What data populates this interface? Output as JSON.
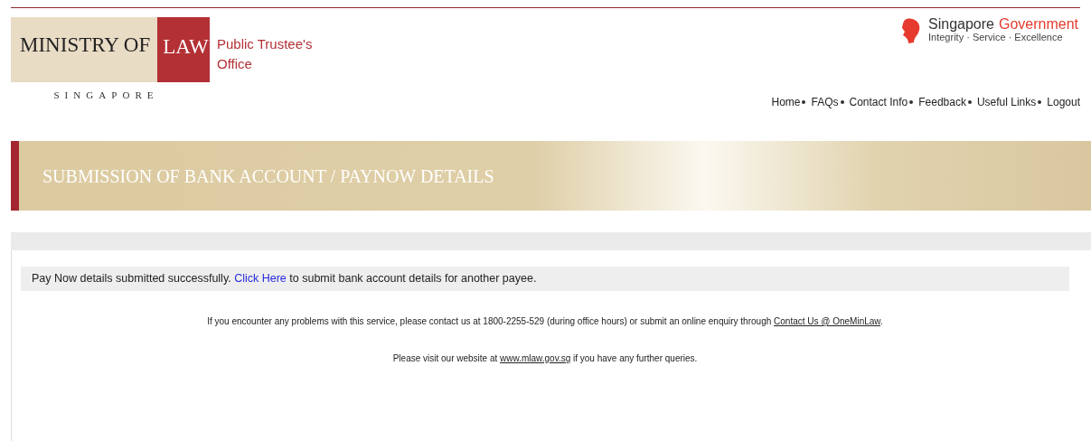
{
  "header": {
    "logo": {
      "ministry": "MINISTRY OF",
      "law": "LAW",
      "country": "SINGAPORE",
      "office_lines": [
        "Public Trustee's",
        "Office"
      ]
    },
    "gov": {
      "name": "Singapore",
      "accent": "Government",
      "tagline": "Integrity · Service · Excellence"
    },
    "nav": [
      {
        "label": "Home"
      },
      {
        "label": "FAQs"
      },
      {
        "label": "Contact Info"
      },
      {
        "label": "Feedback"
      },
      {
        "label": "Useful Links"
      },
      {
        "label": "Logout"
      }
    ]
  },
  "banner": {
    "title": "SUBMISSION OF BANK ACCOUNT / PAYNOW DETAILS"
  },
  "message": [
    {
      "kind": "text",
      "text": "Pay Now details submitted successfully. "
    },
    {
      "kind": "link",
      "text": "Click Here"
    },
    {
      "kind": "text",
      "text": " to submit bank account details for another payee."
    }
  ],
  "notes": [
    [
      {
        "kind": "text",
        "text": "If you encounter any problems with this service, please contact us at 1800-2255-529 (during office hours) or submit an online enquiry through "
      },
      {
        "kind": "underline",
        "text": "Contact Us @ OneMinLaw"
      },
      {
        "kind": "text",
        "text": "."
      }
    ],
    [
      {
        "kind": "text",
        "text": "Please visit our website at "
      },
      {
        "kind": "underline",
        "text": "www.mlaw.gov.sg"
      },
      {
        "kind": "text",
        "text": " if you have any further queries."
      }
    ]
  ]
}
